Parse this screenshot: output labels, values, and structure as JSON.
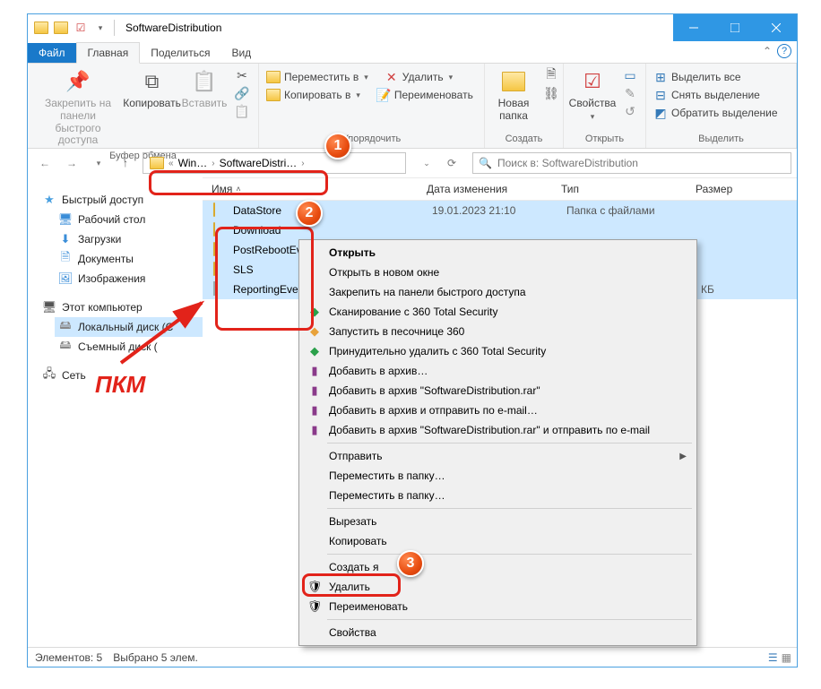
{
  "window": {
    "title": "SoftwareDistribution"
  },
  "tabs": {
    "file": "Файл",
    "home": "Главная",
    "share": "Поделиться",
    "view": "Вид"
  },
  "ribbon": {
    "clipboard": {
      "label": "Буфер обмена",
      "pin": "Закрепить на панели\nбыстрого доступа",
      "copy": "Копировать",
      "paste": "Вставить"
    },
    "organize": {
      "label": "Упорядочить",
      "move_to": "Переместить в",
      "copy_to": "Копировать в",
      "delete": "Удалить",
      "rename": "Переименовать"
    },
    "new": {
      "label": "Создать",
      "new_folder": "Новая\nпапка"
    },
    "open": {
      "label": "Открыть",
      "properties": "Свойства"
    },
    "select": {
      "label": "Выделить",
      "select_all": "Выделить все",
      "select_none": "Снять выделение",
      "invert": "Обратить выделение"
    }
  },
  "nav": {
    "crumb_prefix": "«",
    "crumb1": "Win…",
    "crumb2": "SoftwareDistri…",
    "search_placeholder": "Поиск в: SoftwareDistribution"
  },
  "tree": {
    "quick": "Быстрый доступ",
    "desktop": "Рабочий стол",
    "downloads": "Загрузки",
    "documents": "Документы",
    "pictures": "Изображения",
    "this_pc": "Этот компьютер",
    "local_disk": "Локальный диск (C",
    "removable": "Съемный диск (",
    "network": "Сеть"
  },
  "columns": {
    "name": "Имя",
    "date": "Дата изменения",
    "type": "Тип",
    "size": "Размер"
  },
  "files": [
    {
      "name": "DataStore",
      "date": "19.01.2023 21:10",
      "type": "Папка с файлами",
      "kind": "folder"
    },
    {
      "name": "Download",
      "date": "",
      "type": "",
      "kind": "folder"
    },
    {
      "name": "PostRebootEven",
      "date": "",
      "type": "",
      "kind": "folder"
    },
    {
      "name": "SLS",
      "date": "",
      "type": "",
      "kind": "folder"
    },
    {
      "name": "ReportingEvents",
      "date": "",
      "type": "",
      "size": "КБ",
      "kind": "file"
    }
  ],
  "context": {
    "open": "Открыть",
    "open_new": "Открыть в новом окне",
    "pin_quick": "Закрепить на панели быстрого доступа",
    "scan_360": "Сканирование с 360 Total Security",
    "sandbox_360": "Запустить в песочнице 360",
    "force_del_360": "Принудительно удалить с  360 Total Security",
    "rar_add": "Добавить в архив…",
    "rar_add_named": "Добавить в архив \"SoftwareDistribution.rar\"",
    "rar_email": "Добавить в архив и отправить по e-mail…",
    "rar_named_email": "Добавить в архив \"SoftwareDistribution.rar\" и отправить по e-mail",
    "send_to": "Отправить",
    "move_to_folder": "Переместить в папку…",
    "copy_to_folder": "Переместить в папку…",
    "cut": "Вырезать",
    "copy": "Копировать",
    "create_shortcut": "Создать я",
    "delete": "Удалить",
    "rename": "Переименовать",
    "properties": "Свойства"
  },
  "status": {
    "items": "Элементов: 5",
    "selected": "Выбрано 5 элем."
  },
  "annot": {
    "pkm": "ПКМ",
    "n1": "1",
    "n2": "2",
    "n3": "3"
  }
}
